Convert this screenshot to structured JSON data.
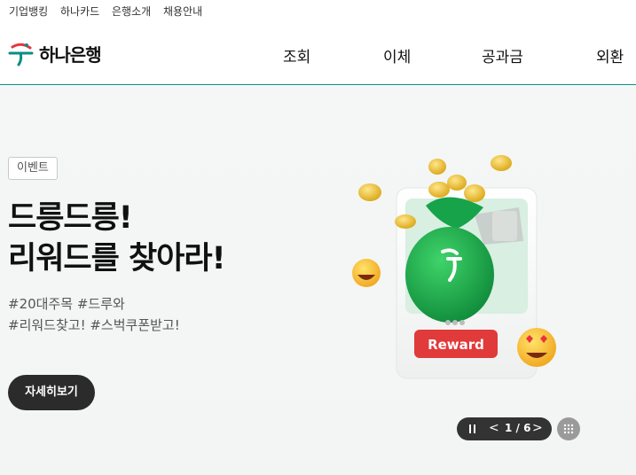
{
  "utility_nav": [
    "기업뱅킹",
    "하나카드",
    "은행소개",
    "채용안내"
  ],
  "brand": {
    "name": "하나은행",
    "color": "#0a8f84"
  },
  "main_nav": [
    "조회",
    "이체",
    "공과금",
    "외환"
  ],
  "hero": {
    "tag": "이벤트",
    "headline": [
      "드릉드릉!",
      "리워드를 찾아라!"
    ],
    "hashtags": [
      "#20대주목 #드루와",
      "#리워드찾고! #스벅쿠폰받고!"
    ],
    "cta": "자세히보기",
    "illustration_badge": "Reward"
  },
  "pager": {
    "prev": "<",
    "count": "1 / 6",
    "next": ">",
    "pause_icon": "pause-icon",
    "grid_icon": "grid-icon"
  }
}
